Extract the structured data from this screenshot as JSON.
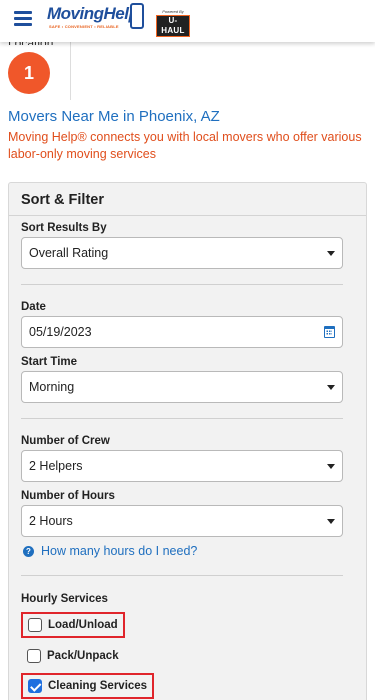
{
  "header": {
    "menu_icon": "hamburger-menu-icon",
    "logo_text": "MovingHelp",
    "logo_tagline": "SAFE • CONVENIENT • RELIABLE",
    "powered_by": "Powered By",
    "uhaul_text": "U-HAUL",
    "brand_color": "#1f4f9c"
  },
  "location": {
    "label": "Location",
    "number": "1"
  },
  "page": {
    "title": "Movers Near Me in Phoenix, AZ",
    "description": "Moving Help® connects you with local movers who offer various labor-only moving services"
  },
  "filter": {
    "title": "Sort & Filter",
    "sort_label": "Sort Results By",
    "sort_value": "Overall Rating",
    "date_label": "Date",
    "date_value": "05/19/2023",
    "start_time_label": "Start Time",
    "start_time_value": "Morning",
    "crew_label": "Number of Crew",
    "crew_value": "2 Helpers",
    "hours_label": "Number of Hours",
    "hours_value": "2 Hours",
    "help_link": "How many hours do I need?",
    "hourly_services_label": "Hourly Services",
    "services": [
      {
        "label": "Load/Unload",
        "checked": false,
        "highlighted": true
      },
      {
        "label": "Pack/Unpack",
        "checked": false,
        "highlighted": false
      },
      {
        "label": "Cleaning Services",
        "checked": true,
        "highlighted": true
      }
    ]
  },
  "colors": {
    "accent_blue": "#1f6fbf",
    "accent_orange": "#f0572a",
    "highlight_red": "#e0252b"
  }
}
